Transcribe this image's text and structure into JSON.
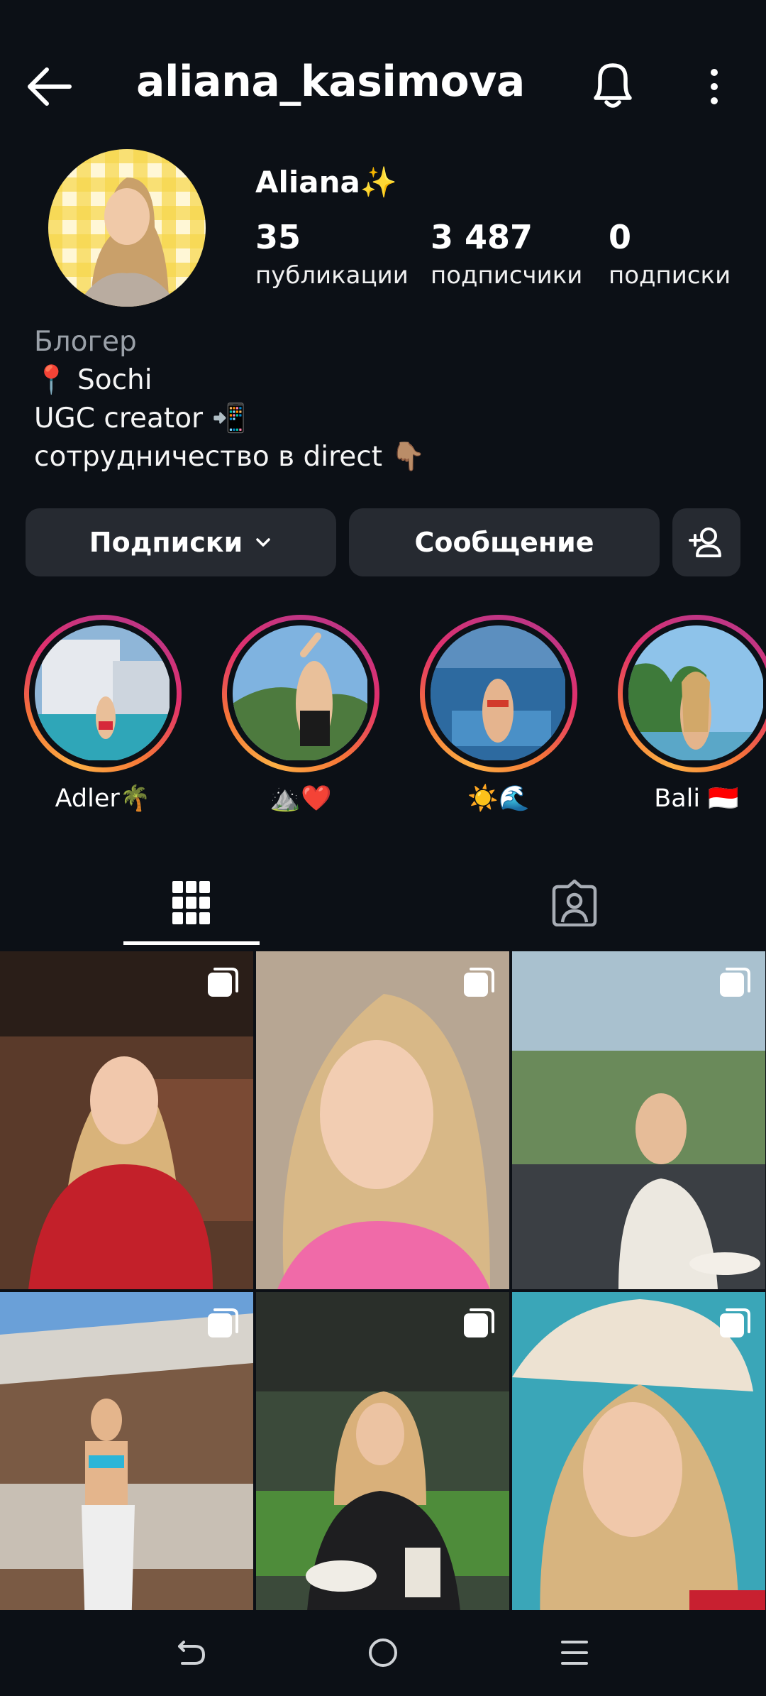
{
  "header": {
    "username": "aliana_kasimova",
    "back_icon": "arrow-left-icon",
    "bell_icon": "bell-icon",
    "more_icon": "more-vertical-icon"
  },
  "profile": {
    "display_name": "Aliana✨",
    "stats": [
      {
        "value": "35",
        "label": "публикации"
      },
      {
        "value": "3 487",
        "label": "подписчики"
      },
      {
        "value": "0",
        "label": "подписки"
      }
    ],
    "bio": {
      "category": "Блогер",
      "lines": [
        "📍 Sochi",
        "UGC creator 📲",
        "сотрудничество в direct 👇🏽"
      ]
    }
  },
  "actions": {
    "following_label": "Подписки",
    "message_label": "Сообщение",
    "add_friend_icon": "person-add-icon"
  },
  "highlights": [
    {
      "label": "Adler🌴"
    },
    {
      "label": "⛰️❤️"
    },
    {
      "label": "☀️🌊"
    },
    {
      "label": "Bali 🇮🇩"
    }
  ],
  "tabs": [
    {
      "name": "grid",
      "icon": "grid-icon",
      "active": true
    },
    {
      "name": "tagged",
      "icon": "tagged-person-icon",
      "active": false
    }
  ],
  "posts": [
    {
      "description": "photo",
      "multi": true
    },
    {
      "description": "photo",
      "multi": true
    },
    {
      "description": "photo",
      "multi": true
    },
    {
      "description": "photo",
      "multi": true
    },
    {
      "description": "photo",
      "multi": true
    },
    {
      "description": "photo",
      "multi": true
    }
  ],
  "system_nav": {
    "back_icon": "nav-back-icon",
    "home_icon": "nav-home-icon",
    "recents_icon": "nav-recents-icon"
  },
  "colors": {
    "background": "#0c1016",
    "button": "#262a31",
    "muted_text": "#9aa0a8",
    "story_ring_start": "#fcaf45",
    "story_ring_end": "#c13584"
  }
}
